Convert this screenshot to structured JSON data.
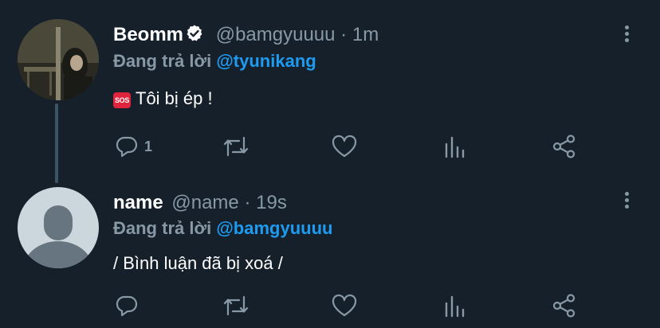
{
  "tweets": [
    {
      "name": "Beomm",
      "handle": "@bamgyuuuu",
      "separator": "·",
      "time": "1m",
      "verified": true,
      "reply_prefix": "Đang trả lời",
      "reply_to": "@tyunikang",
      "emoji": "SOS",
      "text": "Tôi bị ép !",
      "actions": {
        "reply_count": "1",
        "retweet_count": "",
        "like_count": ""
      }
    },
    {
      "name": "name",
      "handle": "@name",
      "separator": "·",
      "time": "19s",
      "verified": false,
      "reply_prefix": "Đang trả lời",
      "reply_to": "@bamgyuuuu",
      "text": "/ Bình luận đã bị xoá /",
      "actions": {
        "reply_count": "",
        "retweet_count": "",
        "like_count": ""
      }
    }
  ],
  "colors": {
    "background": "#15202b",
    "secondary_text": "#8899a6",
    "mention": "#1d9bf0",
    "verified_badge": "#ffffff",
    "sos": "#e0243e"
  },
  "icons": [
    "verified-icon",
    "more-icon",
    "reply-icon",
    "retweet-icon",
    "like-icon",
    "analytics-icon",
    "share-icon"
  ]
}
